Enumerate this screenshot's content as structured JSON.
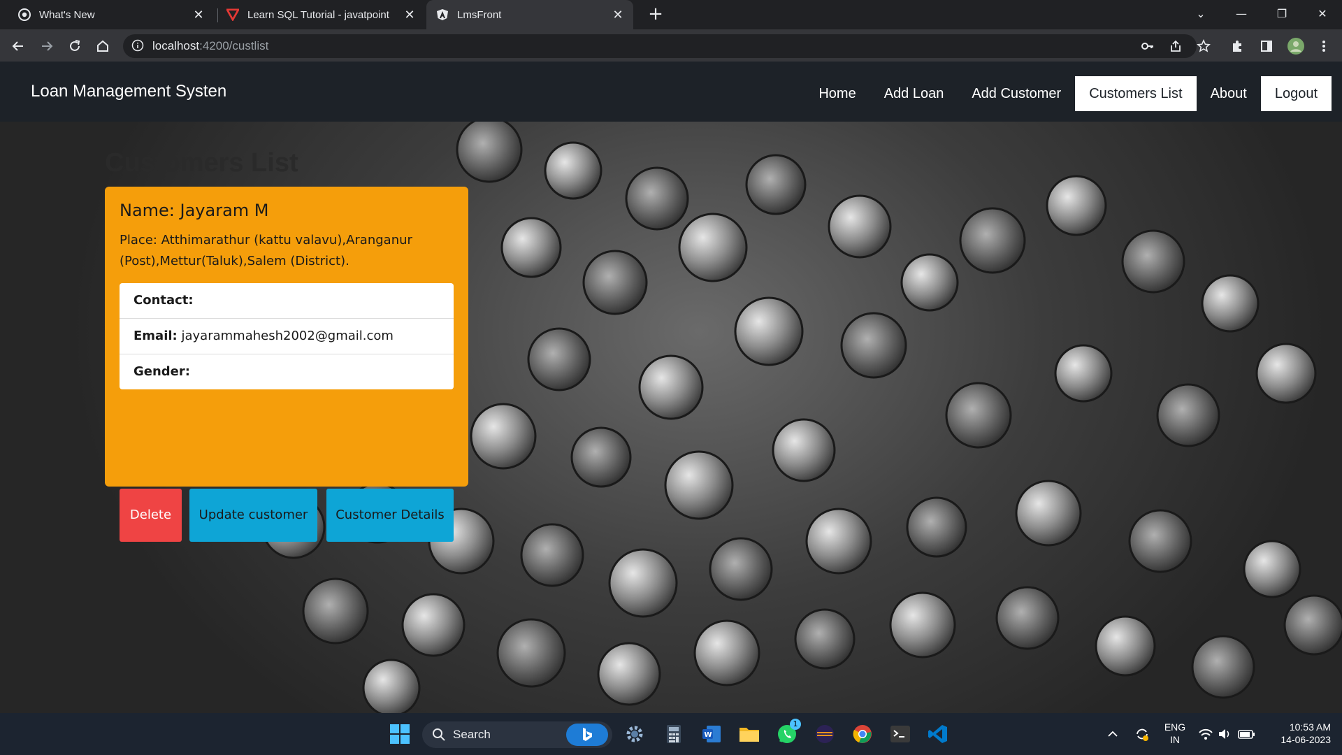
{
  "browser": {
    "tabs": [
      {
        "title": "What's New",
        "icon": "chrome-icon",
        "active": false
      },
      {
        "title": "Learn SQL Tutorial - javatpoint",
        "icon": "javatpoint-icon",
        "active": false
      },
      {
        "title": "LmsFront",
        "icon": "angular-icon",
        "active": true
      }
    ],
    "url_host": "localhost",
    "url_path": ":4200/custlist"
  },
  "navbar": {
    "brand": "Loan Management Systen",
    "links": [
      {
        "label": "Home",
        "active": false
      },
      {
        "label": "Add Loan",
        "active": false
      },
      {
        "label": "Add Customer",
        "active": false
      },
      {
        "label": "Customers List",
        "active": true
      },
      {
        "label": "About",
        "active": false
      }
    ],
    "logout": "Logout"
  },
  "page": {
    "heading": "Customers List"
  },
  "customer": {
    "name": "Name: Jayaram M",
    "place": "Place: Atthimarathur (kattu valavu),Aranganur (Post),Mettur(Taluk),Salem (District).",
    "contact_label": "Contact:",
    "contact_value": "",
    "email_label": "Email:",
    "email_value": "jayarammahesh2002@gmail.com",
    "gender_label": "Gender:",
    "gender_value": "",
    "delete_label": "Delete",
    "update_label": "Update customer",
    "details_label": "Customer Details"
  },
  "taskbar": {
    "search_label": "Search",
    "whatsapp_badge": "1",
    "lang_top": "ENG",
    "lang_bottom": "IN",
    "time": "10:53 AM",
    "date": "14-06-2023"
  },
  "colors": {
    "card": "#f59e0b",
    "delete": "#ef4444",
    "primary": "#0ea5d6",
    "navbar": "#1d2228"
  }
}
